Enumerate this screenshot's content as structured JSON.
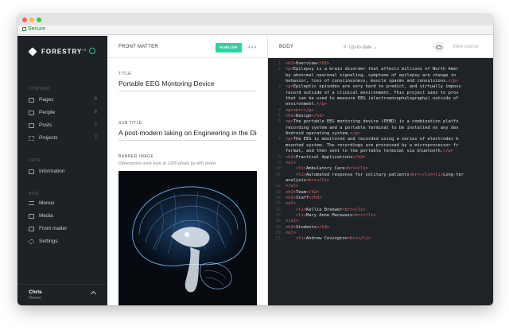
{
  "browser": {
    "secure_label": "Secure"
  },
  "colors": {
    "accent": "#2fd3a2",
    "sidebar_bg": "#1e2227",
    "editor_bg": "#1f2328",
    "tag_color": "#e86a6a"
  },
  "sidebar": {
    "brand": "FORESTRY",
    "brand_tm": "IO",
    "content_section": "CONTENT",
    "content_items": [
      {
        "label": "Pages",
        "count": "6",
        "icon": "folder-icon"
      },
      {
        "label": "People",
        "count": "6",
        "icon": "people-icon"
      },
      {
        "label": "Posts",
        "count": "2",
        "icon": "posts-icon"
      },
      {
        "label": "Projects",
        "count": "2",
        "icon": "projects-icon"
      }
    ],
    "data_section": "DATA",
    "data_items": [
      {
        "label": "Information",
        "icon": "information-icon"
      }
    ],
    "site_section": "SITE",
    "site_items": [
      {
        "label": "Menus",
        "icon": "menu-icon"
      },
      {
        "label": "Media",
        "icon": "media-icon"
      },
      {
        "label": "Front matter",
        "icon": "front-matter-icon"
      },
      {
        "label": "Settings",
        "icon": "gear-icon"
      }
    ],
    "user": {
      "name": "Chris",
      "role": "Owner"
    }
  },
  "front_matter": {
    "heading": "FRONT MATTER",
    "publish_label": "PUBLISH",
    "more_label": "•••",
    "title_label": "TITLE",
    "title_value": "Portable EEG Montoring Device",
    "subtitle_label": "SUB TITLE",
    "subtitle_value": "A post-modern taking on Engineering in the Digita",
    "banner_label": "BANNER IMAGE",
    "banner_hint": "Dimensions work best at 1200 pixels by 400 pixels"
  },
  "body": {
    "heading": "BODY",
    "status": "Up-to-date",
    "view_source": "View source",
    "lines": [
      {
        "n": "1",
        "code": "<h2>Overview</h2>"
      },
      {
        "n": "2",
        "code": "<p>Epilepsy is a brain disorder that affects millions of North Amer"
      },
      {
        "n": "",
        "code": "by abnormal neuronal signaling, symptoms of epilepsy are change in"
      },
      {
        "n": "",
        "code": "behavior, loss of consciousness, muscle spasms and convulsions.</p>"
      },
      {
        "n": "3",
        "code": "<p>Epileptic episodes are very hard to predict, and virtually imposs"
      },
      {
        "n": "",
        "code": "record outside of a clinical environment. This project aims to prov"
      },
      {
        "n": "",
        "code": "that can be used to measure EEG (electroencephalography) outside of"
      },
      {
        "n": "",
        "code": "environment.</p>"
      },
      {
        "n": "4",
        "code": "<p><br></p>"
      },
      {
        "n": "5",
        "code": "<h2>Design</h2>"
      },
      {
        "n": "6",
        "code": "<p>The portable EEG montoring device (PEMD) is a combination platfo"
      },
      {
        "n": "",
        "code": "recording system and a portable terminal to be installed on any dev"
      },
      {
        "n": "",
        "code": "Android operating system.</p>"
      },
      {
        "n": "7",
        "code": "<p>The EEG is monitored and recorded using a series of electrodes b"
      },
      {
        "n": "",
        "code": "mounted system. The recordings are processed by a microprocessor fr"
      },
      {
        "n": "",
        "code": "format, and then sent to the portable terminal via bluetooth.</p>"
      },
      {
        "n": "8",
        "code": "<h2>Practical Applications</h2>"
      },
      {
        "n": "9",
        "code": "<ul>"
      },
      {
        "n": "10",
        "code": "    <li>Ambulatory Care<br></li>"
      },
      {
        "n": "11",
        "code": "    <li>Automated response for solitary patients<br></li><li>Long-ter"
      },
      {
        "n": "",
        "code": "analysis<br></li>"
      },
      {
        "n": "12",
        "code": "</ul>"
      },
      {
        "n": "13",
        "code": "<h2>Team</h2>"
      },
      {
        "n": "14",
        "code": "<h3>Staff</h3>"
      },
      {
        "n": "15",
        "code": "<ul>"
      },
      {
        "n": "16",
        "code": "    <li>Kellie Breewer<br></li>"
      },
      {
        "n": "17",
        "code": "    <li>Mary Anne Macewain<br></li>"
      },
      {
        "n": "18",
        "code": "</ul>"
      },
      {
        "n": "19",
        "code": "<h3>Students</h3>"
      },
      {
        "n": "20",
        "code": "<ul>"
      },
      {
        "n": "21",
        "code": "    <li>Andrew Covington<br></li>"
      }
    ]
  }
}
